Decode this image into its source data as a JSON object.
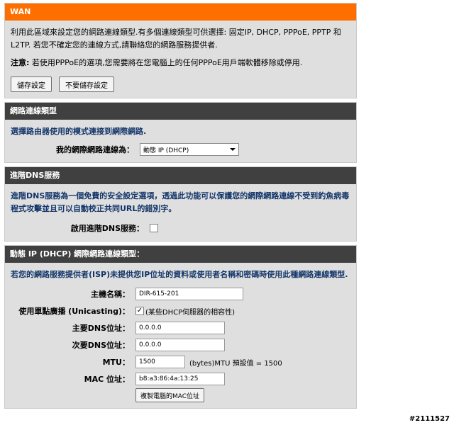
{
  "wan": {
    "title": "WAN",
    "intro": "利用此區域來設定您的網路連線類型.有多個連線類型可供選擇: 固定IP, DHCP, PPPoE, PPTP 和 L2TP. 若您不確定您的連線方式,請聯絡您的網路服務提供者.",
    "note_label": "注意:",
    "note_text": "若使用PPPoE的選項,您需要將在您電腦上的任何PPPoE用戶端軟體移除或停用.",
    "save_label": "儲存設定",
    "nosave_label": "不要儲存設定"
  },
  "conn_type": {
    "title": "網路連線類型",
    "desc": "選擇路由器使用的模式連接到網際網路.",
    "label": "我的網際網路連線為：",
    "selected": "動態 IP (DHCP)"
  },
  "dns": {
    "title": "進階DNS服務",
    "desc": "進階DNS服務為一個免費的安全設定選項，透過此功能可以保護您的網際網路連線不受到釣魚病毒程式攻擊並且可以自動校正共同URL的錯別字。",
    "enable_label": "啟用進階DNS服務：",
    "enabled": false
  },
  "dhcp": {
    "title": "動態 IP (DHCP) 網際網路連線類型：",
    "desc": "若您的網路服務提供者(ISP)未提供您IP位址的資料或使用者名稱和密碼時使用此種網路連線類型.",
    "host_label": "主機名稱：",
    "host_value": "DIR-615-201",
    "unicast_label": "使用單點廣播 (Unicasting)：",
    "unicast_hint": "(某些DHCP伺服器的相容性)",
    "unicast_checked": true,
    "dns1_label": "主要DNS位址：",
    "dns1_value": "0.0.0.0",
    "dns2_label": "次要DNS位址：",
    "dns2_value": "0.0.0.0",
    "mtu_label": "MTU：",
    "mtu_value": "1500",
    "mtu_hint": "(bytes)MTU 預設值 = 1500",
    "mac_label": "MAC 位址：",
    "mac_value": "b8:a3:86:4a:13:25",
    "clone_label": "複製電腦的MAC位址"
  },
  "watermark": "#2111527"
}
